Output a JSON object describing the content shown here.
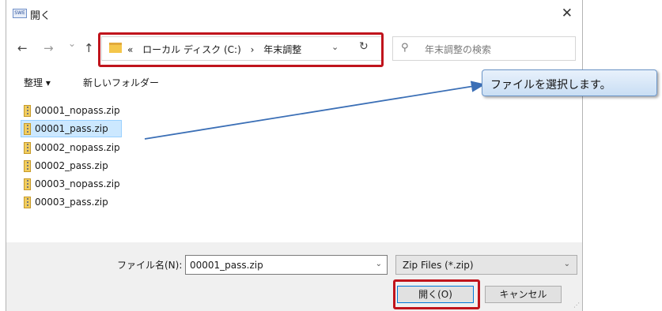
{
  "window": {
    "app_icon_text": "SWE",
    "title": "開く",
    "close_symbol": "✕"
  },
  "nav": {
    "back_symbol": "←",
    "forward_symbol": "→",
    "recent_symbol": "⌄",
    "up_symbol": "↑",
    "breadcrumb_prefix": "«",
    "breadcrumb": [
      "ローカル ディスク (C:)",
      "›",
      "年末調整"
    ],
    "dropdown_symbol": "⌄",
    "refresh_symbol": "↻",
    "search_placeholder": "年末調整の検索"
  },
  "toolbar": {
    "organize_label": "整理 ▾",
    "new_folder_label": "新しいフォルダー"
  },
  "files": [
    {
      "name": "00001_nopass.zip",
      "selected": false
    },
    {
      "name": "00001_pass.zip",
      "selected": true
    },
    {
      "name": "00002_nopass.zip",
      "selected": false
    },
    {
      "name": "00002_pass.zip",
      "selected": false
    },
    {
      "name": "00003_nopass.zip",
      "selected": false
    },
    {
      "name": "00003_pass.zip",
      "selected": false
    }
  ],
  "footer": {
    "filename_label": "ファイル名(N):",
    "filename_value": "00001_pass.zip",
    "filetype_value": "Zip Files (*.zip)",
    "dropdown_symbol": "⌄",
    "open_label": "開く(O)",
    "cancel_label": "キャンセル"
  },
  "annotation": {
    "callout_text": "ファイルを選択します。",
    "highlight_color": "#c0141c",
    "arrow_color": "#3b6fb6"
  }
}
